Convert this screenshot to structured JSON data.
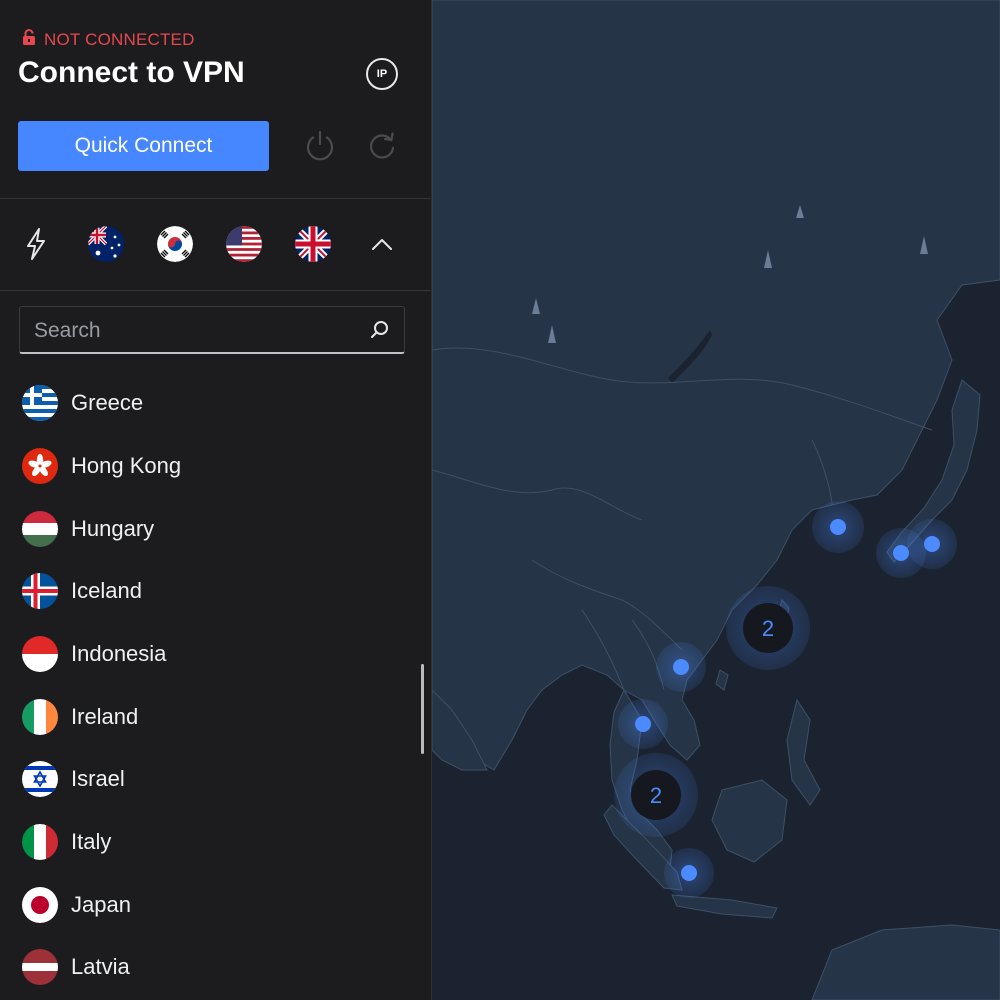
{
  "status": {
    "text": "NOT CONNECTED",
    "color": "#e5484d",
    "icon": "unlocked-padlock-icon"
  },
  "header": {
    "title": "Connect to VPN",
    "ip_label": "IP"
  },
  "actions": {
    "quick_connect_label": "Quick Connect",
    "power_icon": "power-icon",
    "refresh_icon": "refresh-icon"
  },
  "recents": [
    {
      "name": "quick-connect-lightning",
      "icon": "lightning-icon"
    },
    {
      "name": "Australia",
      "icon": "flag-australia"
    },
    {
      "name": "South Korea",
      "icon": "flag-south-korea"
    },
    {
      "name": "United States",
      "icon": "flag-united-states"
    },
    {
      "name": "United Kingdom",
      "icon": "flag-united-kingdom"
    },
    {
      "name": "collapse",
      "icon": "chevron-up-icon"
    }
  ],
  "search": {
    "placeholder": "Search",
    "value": ""
  },
  "countries": [
    {
      "name": "Greece",
      "flag": "flag-greece"
    },
    {
      "name": "Hong Kong",
      "flag": "flag-hong-kong"
    },
    {
      "name": "Hungary",
      "flag": "flag-hungary"
    },
    {
      "name": "Iceland",
      "flag": "flag-iceland"
    },
    {
      "name": "Indonesia",
      "flag": "flag-indonesia"
    },
    {
      "name": "Ireland",
      "flag": "flag-ireland"
    },
    {
      "name": "Israel",
      "flag": "flag-israel"
    },
    {
      "name": "Italy",
      "flag": "flag-italy"
    },
    {
      "name": "Japan",
      "flag": "flag-japan"
    },
    {
      "name": "Latvia",
      "flag": "flag-latvia"
    }
  ],
  "map": {
    "clusters": [
      {
        "label": "2"
      },
      {
        "label": "2"
      }
    ],
    "colors": {
      "land": "#253446",
      "water": "#1b2330",
      "marker": "#4c8bff"
    }
  }
}
